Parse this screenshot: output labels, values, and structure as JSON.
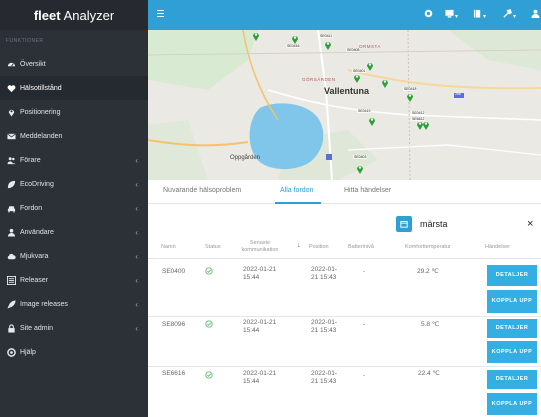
{
  "app": {
    "brand": "fleet",
    "name": "Analyzer"
  },
  "sidebar": {
    "section_label": "FUNKTIONER",
    "items": [
      {
        "label": "Översikt",
        "icon": "dashboard-icon",
        "has_submenu": false
      },
      {
        "label": "Hälsotillstånd",
        "icon": "heart-icon",
        "has_submenu": false,
        "active": true
      },
      {
        "label": "Positionering",
        "icon": "map-marker-icon",
        "has_submenu": false
      },
      {
        "label": "Meddelanden",
        "icon": "envelope-icon",
        "has_submenu": false
      },
      {
        "label": "Förare",
        "icon": "users-icon",
        "has_submenu": true
      },
      {
        "label": "EcoDriving",
        "icon": "leaf-icon",
        "has_submenu": true
      },
      {
        "label": "Fordon",
        "icon": "car-icon",
        "has_submenu": true
      },
      {
        "label": "Användare",
        "icon": "user-icon",
        "has_submenu": true
      },
      {
        "label": "Mjukvara",
        "icon": "cloud-icon",
        "has_submenu": true
      },
      {
        "label": "Releaser",
        "icon": "list-icon",
        "has_submenu": true
      },
      {
        "label": "Image releases",
        "icon": "rocket-icon",
        "has_submenu": true
      },
      {
        "label": "Site admin",
        "icon": "lock-icon",
        "has_submenu": true
      },
      {
        "label": "Hjälp",
        "icon": "help-icon",
        "has_submenu": false
      }
    ]
  },
  "topbar": {
    "icons": [
      "menu-icon",
      "globe-icon",
      "monitor-icon",
      "book-icon",
      "settings-icon",
      "user-icon"
    ]
  },
  "map": {
    "town": "Vallentuna",
    "area_labels": [
      "ORMSTA",
      "GÖRSÄRDEN",
      "Oppgården"
    ],
    "vehicle_tags": [
      "SE0416",
      "SE0411",
      "SE0401",
      "SE0419",
      "SE0418",
      "SE0412",
      "SE6612",
      "SE0403",
      "SE0408"
    ],
    "road_badge": "268"
  },
  "tabs": [
    {
      "label": "Nuvarande hälsoproblem",
      "active": false
    },
    {
      "label": "Alla fordon",
      "active": true
    },
    {
      "label": "Hitta händelser",
      "active": false
    }
  ],
  "search": {
    "value": "märsta",
    "clear": "×"
  },
  "table": {
    "headers": {
      "name": "Namn",
      "status": "Status",
      "last_comm": "Senaste kommunikation",
      "sort_indicator": "↓",
      "position": "Position",
      "battery": "Batterinivå",
      "comfort_temp": "Komforttemperatur",
      "events": "Händelser"
    },
    "rows": [
      {
        "name": "SE0400",
        "status": "ok",
        "last_comm": "2022-01-21 15:44",
        "position": "2022-01-21 15:43",
        "battery": "-",
        "comfort_temp": "29.2 ℃"
      },
      {
        "name": "SE8096",
        "status": "ok",
        "last_comm": "2022-01-21 15:44",
        "position": "2022-01-21 15:43",
        "battery": "-",
        "comfort_temp": "5.8 ℃"
      },
      {
        "name": "SE6616",
        "status": "ok",
        "last_comm": "2022-01-21 15:44",
        "position": "2022-01-21 15:43",
        "battery": "-",
        "comfort_temp": "22.4 ℃"
      }
    ],
    "actions": {
      "details": "DETALJER",
      "connect": "KOPPLA UPP"
    }
  },
  "colors": {
    "sidebar_bg": "#2c3138",
    "topbar_bg": "#2f9fd6",
    "accent": "#35aee3",
    "status_ok": "#6bc07a",
    "pin_green": "#2e9e3a",
    "water": "#79c3ea"
  }
}
